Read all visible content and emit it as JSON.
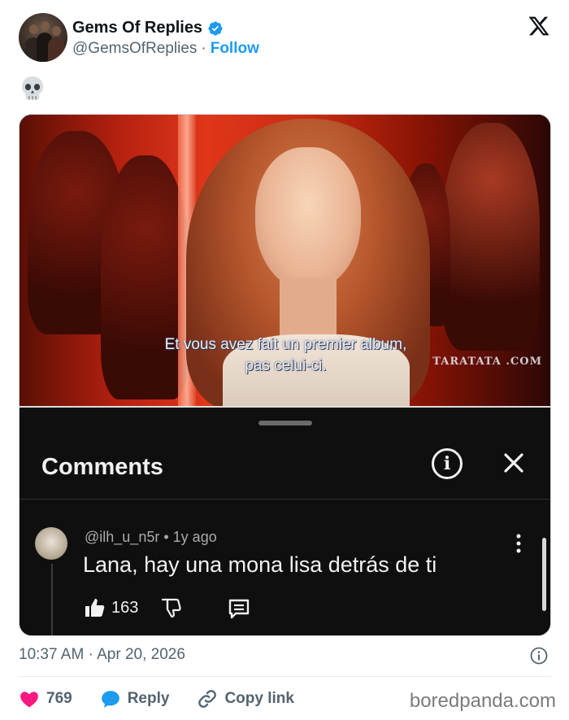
{
  "post": {
    "author_name": "Gems Of Replies",
    "author_handle": "@GemsOfReplies",
    "separator": "·",
    "follow_label": "Follow",
    "body_emoji_icon": "skull-icon",
    "timestamp": "10:37 AM · Apr 20, 2026"
  },
  "video": {
    "subtitle_line1": "Et vous avez fait un premier album,",
    "subtitle_line2": "pas celui-ci.",
    "watermark": "TARATATA .COM"
  },
  "comments_sheet": {
    "title": "Comments",
    "comment": {
      "username": "@ilh_u_n5r",
      "age": "1y ago",
      "text": "Lana, hay una mona lisa detrás de ti",
      "likes": "163"
    }
  },
  "actions": {
    "likes": "769",
    "reply_label": "Reply",
    "copy_link_label": "Copy link"
  },
  "credit": "boredpanda.com",
  "colors": {
    "accent": "#1d9bf0",
    "like": "#f91880",
    "sheet_bg": "#0f0f0f"
  }
}
